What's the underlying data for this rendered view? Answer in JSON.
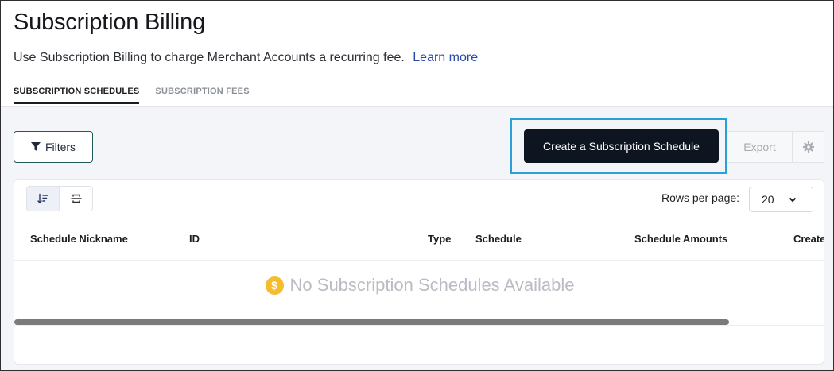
{
  "page": {
    "title": "Subscription Billing",
    "description": "Use Subscription Billing to charge Merchant Accounts a recurring fee.",
    "learn_more": "Learn more"
  },
  "tabs": [
    {
      "label": "SUBSCRIPTION SCHEDULES",
      "active": true
    },
    {
      "label": "SUBSCRIPTION FEES",
      "active": false
    }
  ],
  "toolbar": {
    "filters_label": "Filters",
    "create_label": "Create a Subscription Schedule",
    "export_label": "Export"
  },
  "table": {
    "rows_per_page_label": "Rows per page:",
    "rows_per_page_value": "20",
    "columns": [
      "Schedule Nickname",
      "ID",
      "Type",
      "Schedule",
      "Schedule Amounts",
      "Create"
    ],
    "empty_message": "No Subscription Schedules Available",
    "empty_icon_glyph": "$"
  },
  "colors": {
    "accent_highlight": "#2a9fd8",
    "primary_button": "#0f1520",
    "link": "#2a4aa8",
    "empty_coin": "#f5bc2e"
  }
}
